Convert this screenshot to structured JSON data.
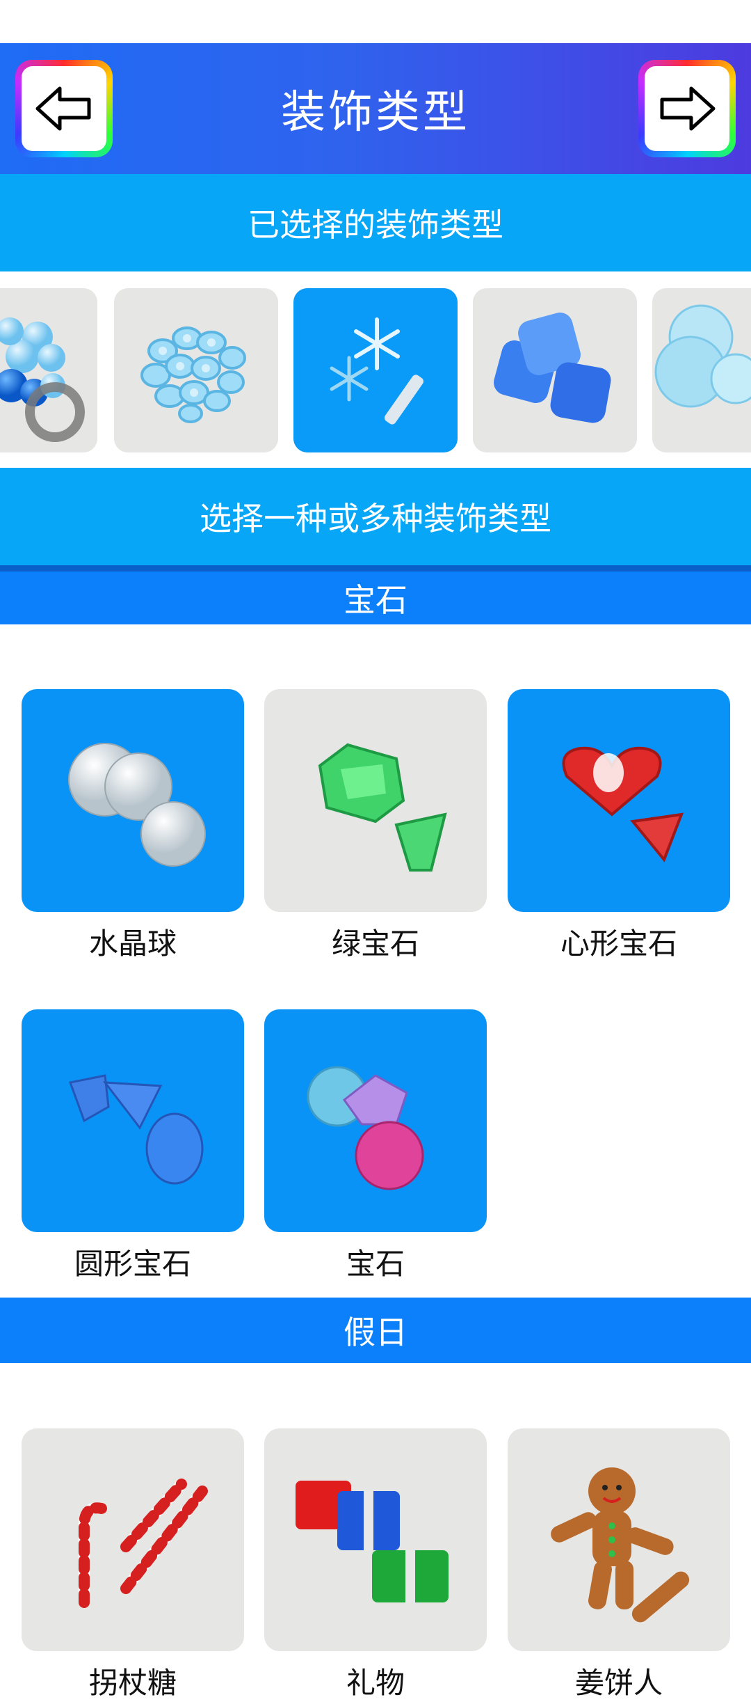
{
  "header": {
    "title": "装饰类型",
    "back_icon": "arrow-left-icon",
    "next_icon": "arrow-right-icon"
  },
  "selected_section": {
    "label": "已选择的装饰类型",
    "items": [
      {
        "icon": "blue-balls-icon",
        "selected": false
      },
      {
        "icon": "blue-rings-icon",
        "selected": false
      },
      {
        "icon": "snowflake-icon",
        "selected": true
      },
      {
        "icon": "blue-cubes-icon",
        "selected": false
      },
      {
        "icon": "bubbles-icon",
        "selected": false
      }
    ]
  },
  "choose_label": "选择一种或多种装饰类型",
  "gems": {
    "title": "宝石",
    "items": [
      {
        "label": "水晶球",
        "icon": "crystal-ball-icon",
        "selected": true
      },
      {
        "label": "绿宝石",
        "icon": "emerald-icon",
        "selected": false
      },
      {
        "label": "心形宝石",
        "icon": "heart-gem-icon",
        "selected": true
      },
      {
        "label": "圆形宝石",
        "icon": "round-gem-icon",
        "selected": true
      },
      {
        "label": "宝石",
        "icon": "gem-icon",
        "selected": true
      }
    ]
  },
  "holiday": {
    "title": "假日",
    "items": [
      {
        "label": "拐杖糖",
        "icon": "candy-cane-icon",
        "selected": false
      },
      {
        "label": "礼物",
        "icon": "gift-icon",
        "selected": false
      },
      {
        "label": "姜饼人",
        "icon": "gingerbread-man-icon",
        "selected": false
      }
    ]
  },
  "colors": {
    "header_start": "#1f6cf5",
    "header_end": "#4d3be0",
    "band": "#08a6f7",
    "section_bar": "#0c80fa",
    "selected_tile": "#0a93f7",
    "unselected_tile": "#e6e6e4"
  }
}
